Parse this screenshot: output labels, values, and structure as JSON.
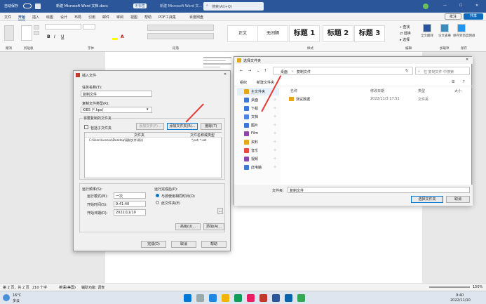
{
  "titlebar": {
    "autosave": "自动保存",
    "title": "新建 Microsoft Word 文档.docx",
    "badge": "无标签",
    "doc_label": "新建 Microsoft Word 文...",
    "search": "搜索(Alt+Q)"
  },
  "menu": [
    "文件",
    "开始",
    "插入",
    "绘图",
    "设计",
    "布局",
    "引用",
    "邮件",
    "审阅",
    "视图",
    "帮助",
    "PDF工具集",
    "百度网盘"
  ],
  "menu_active": 1,
  "ribbon_right": {
    "comment": "批注",
    "share": "共享"
  },
  "ribbon_groups": {
    "undo": "撤消",
    "clipboard": "剪贴板",
    "font": "字体",
    "paragraph": "段落",
    "styles": "样式",
    "editing": "编辑",
    "assist": "加载项",
    "save": "保存"
  },
  "styles": [
    {
      "label": "正文",
      "big": false
    },
    {
      "label": "无间隔",
      "big": false
    },
    {
      "label": "标题 1",
      "big": true
    },
    {
      "label": "标题 2",
      "big": true
    },
    {
      "label": "标题 3",
      "big": true
    }
  ],
  "editing": {
    "find": "查找",
    "replace": "替换",
    "select": "选择"
  },
  "assist": {
    "a": "全文翻译",
    "b": "论文查重",
    "c": "保存到百度网盘"
  },
  "status": {
    "page": "第 2 页，共 2 页",
    "words": "210 个字",
    "lang": "英语(美国)",
    "access": "辅助功能: 调查",
    "zoom": "150%"
  },
  "taskbar": {
    "weather": "16°C",
    "weather2": "多云",
    "time": "9:40",
    "date": "2022/11/10"
  },
  "insdlg": {
    "title": "插入文件",
    "task_label": "任务名称(T):",
    "task_value": "复制文件",
    "folder_label": "复制文件类型(K):",
    "folder_value": "KIES (*.kps)",
    "group_label": "将要复制的文件夹",
    "include_sub": "包括子文件夹",
    "btn_add_file": "添加文件(F)...",
    "btn_add_folder": "添加文件夹(R)...",
    "btn_delete": "删除(T)",
    "col_file": "文件夹",
    "col_type": "文件名称或类型",
    "row_path": "C:\\Users\\Lenovo\\Desktop\\复制文件\\测试",
    "row_type": "*.pst; *.ost",
    "schedule_label": "运行频率(S):",
    "freq_label": "运行模式(M):",
    "freq_value": "一次",
    "start_time_label": "开始时间(S):",
    "start_time": "9:41:40",
    "start_date_label": "开始日期(D):",
    "start_date": "2022/11/10",
    "after_label": "运行完成后(P):",
    "opt1": "与源使用相同时间(O)",
    "opt2": "此文件夹(E)",
    "btn_adv": "高级(U)...",
    "btn_addf": "添加(A)...",
    "btn_ok": "完成(D)",
    "btn_cancel": "取消",
    "btn_help": "帮助"
  },
  "folderdlg": {
    "title": "选择文件夹",
    "path": [
      "桌面",
      "复制文件"
    ],
    "search_placeholder": "在 复制文件 中搜索",
    "organize": "组织",
    "new_folder": "新建文件夹",
    "nav": [
      {
        "label": "主文件夹",
        "color": "#e6a817"
      },
      {
        "label": "桌面",
        "color": "#3b78d8"
      },
      {
        "label": "下载",
        "color": "#3b78d8"
      },
      {
        "label": "文档",
        "color": "#4a86e8"
      },
      {
        "label": "图片",
        "color": "#3b78d8"
      },
      {
        "label": "Film",
        "color": "#8e44ad"
      },
      {
        "label": "资料",
        "color": "#e6a817"
      },
      {
        "label": "音乐",
        "color": "#e74c3c"
      },
      {
        "label": "视频",
        "color": "#8e44ad"
      },
      {
        "label": "此电脑",
        "color": "#3b78d8"
      }
    ],
    "cols": [
      "名称",
      "修改日期",
      "类型",
      "大小"
    ],
    "file": {
      "name": "测试数据",
      "date": "2022/11/3 17:51",
      "type": "文件夹"
    },
    "fname_label": "文件夹:",
    "fname_value": "复制文件",
    "btn_select": "选择文件夹",
    "btn_cancel": "取消"
  },
  "colors": {
    "accent": "#2b579a",
    "arrow": "#e53935",
    "share": "#0f6cbd",
    "highlight": "#ff0",
    "fontred": "#d00"
  }
}
